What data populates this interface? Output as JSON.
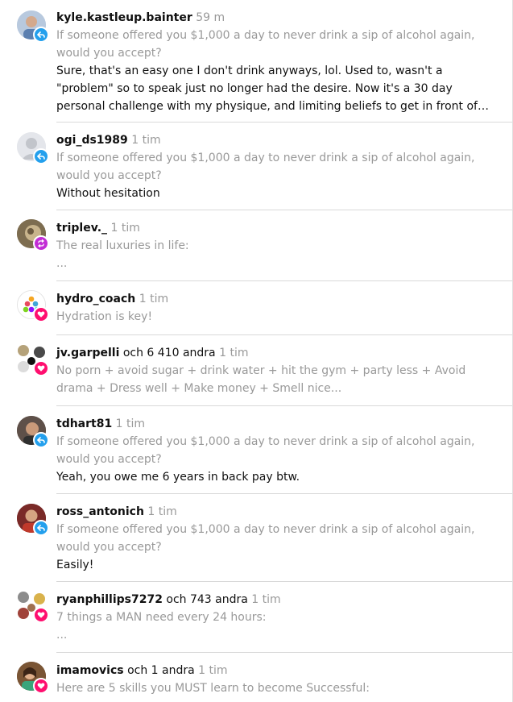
{
  "colors": {
    "reply": "#24a0ed",
    "repost": "#c22dd5",
    "like": "#ff0f6f",
    "muted": "#999999",
    "divider": "#d9d9d9"
  },
  "items": [
    {
      "user": "kyle.kastleup.bainter",
      "time": "59 m",
      "badge": "reply",
      "quote": "If someone offered you $1,000 a day to never drink a sip of alcohol again, would you accept?",
      "reply": "Sure, that's an easy one I don't drink anyways, lol. Used to, wasn't a \"problem\" so to speak just no longer had the desire. Now it's a 30 day personal challenge with my physique, and limiting beliefs to get in front of the darn camera already, but..."
    },
    {
      "user": "ogi_ds1989",
      "time": "1 tim",
      "badge": "reply",
      "quote": "If someone offered you $1,000 a day to never drink a sip of alcohol again, would you accept?",
      "reply": "Without hesitation"
    },
    {
      "user": "triplev._",
      "time": "1 tim",
      "badge": "repost",
      "quote": "The real luxuries in life:",
      "reply": "..."
    },
    {
      "user": "hydro_coach",
      "time": "1 tim",
      "badge": "like",
      "quote": "Hydration is key!"
    },
    {
      "user": "jv.garpelli",
      "others": "och 6 410 andra",
      "time": "1 tim",
      "badge": "like",
      "quote": "No porn + avoid sugar + drink water + hit the gym + party less + Avoid drama + Dress well + Make money + Smell nice..."
    },
    {
      "user": "tdhart81",
      "time": "1 tim",
      "badge": "reply",
      "quote": "If someone offered you $1,000 a day to never drink a sip of alcohol again, would you accept?",
      "reply": "Yeah, you owe me 6 years in back pay btw."
    },
    {
      "user": "ross_antonich",
      "time": "1 tim",
      "badge": "reply",
      "quote": "If someone offered you $1,000 a day to never drink a sip of alcohol again, would you accept?",
      "reply": "Easily!"
    },
    {
      "user": "ryanphillips7272",
      "others": "och 743 andra",
      "time": "1 tim",
      "badge": "like",
      "quote": "7 things a MAN need every 24 hours:",
      "reply": "..."
    },
    {
      "user": "imamovics",
      "others": "och 1 andra",
      "time": "1 tim",
      "badge": "like",
      "quote": "Here are 5 skills you MUST learn to become Successful:"
    }
  ]
}
